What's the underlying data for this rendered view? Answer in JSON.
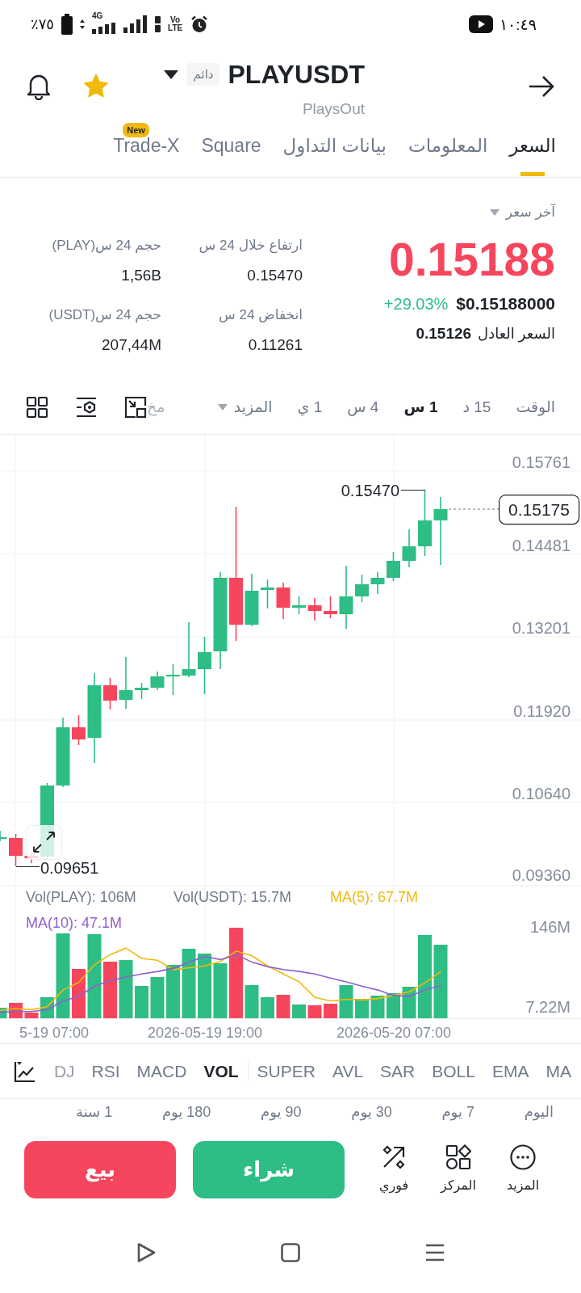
{
  "status_bar": {
    "time": "١٠:٤٩",
    "battery": "٧٥٪",
    "network": "4G",
    "volte_lines": [
      "Vo",
      "LTE"
    ]
  },
  "header": {
    "symbol": "PLAYUSDT",
    "tag": "دائم",
    "subtitle": "PlaysOut",
    "favorite": true
  },
  "tabs": [
    {
      "label": "السعر",
      "selected": true
    },
    {
      "label": "المعلومات",
      "selected": false
    },
    {
      "label": "بيانات التداول",
      "selected": false
    },
    {
      "label": "Square",
      "selected": false
    },
    {
      "badge": "New",
      "label": "Trade-X",
      "selected": false
    }
  ],
  "price_panel": {
    "label": "آخر سعر",
    "last_price": "0.15188",
    "usd_price": "$0.15188000",
    "change": "+29.03%",
    "fair_price_label": "السعر العادل",
    "fair_price": "0.15126"
  },
  "stats": [
    {
      "label": "ارتفاع خلال 24 س",
      "value": "0.15470"
    },
    {
      "label": "حجم 24 س(PLAY)",
      "value": "1,56B"
    },
    {
      "label": "انخفاض 24 س",
      "value": "0.11261"
    },
    {
      "label": "حجم 24 س(USDT)",
      "value": "207,44M"
    }
  ],
  "intervals": [
    {
      "label": "الوقت",
      "selected": false
    },
    {
      "label": "15 د",
      "selected": false
    },
    {
      "label": "1 س",
      "selected": true
    },
    {
      "label": "4 س",
      "selected": false
    },
    {
      "label": "1 ي",
      "selected": false
    }
  ],
  "more_menu": {
    "label": "المزيد"
  },
  "faded_tab": "مخ",
  "chart": {
    "price_axis": [
      "0.15761",
      "0.14481",
      "0.13201",
      "0.11920",
      "0.10640",
      "0.09360"
    ],
    "current_price": "0.15175",
    "high_marker": "0.15470",
    "low_marker": "0.09651",
    "volume_legend": [
      {
        "label": "MA(5): 67.7M",
        "color": "#f0b90b"
      },
      {
        "label": "Vol(USDT): 15.7M",
        "color": "#707a8a"
      },
      {
        "label": "Vol(PLAY): 106M",
        "color": "#707a8a"
      },
      {
        "label": "MA(10): 47.1M",
        "color": "#8e5fd0"
      }
    ],
    "volume_axis": [
      "146M",
      "7.22M"
    ],
    "time_axis": [
      "2026-05-20 07:00",
      "2026-05-19 19:00",
      "5-19 07:00"
    ]
  },
  "main_indicators": [
    {
      "label": "MA",
      "selected": false
    },
    {
      "label": "EMA",
      "selected": false
    },
    {
      "label": "BOLL",
      "selected": false
    },
    {
      "label": "SAR",
      "selected": false
    },
    {
      "label": "AVL",
      "selected": false
    },
    {
      "label": "SUPER",
      "selected": false
    }
  ],
  "sub_indicators": [
    {
      "label": "VOL",
      "selected": true,
      "faded": false
    },
    {
      "label": "MACD",
      "selected": false,
      "faded": false
    },
    {
      "label": "RSI",
      "selected": false,
      "faded": false
    },
    {
      "label": "DJ",
      "selected": false,
      "faded": true
    }
  ],
  "ranges": [
    "اليوم",
    "7 يوم",
    "30 يوم",
    "90 يوم",
    "180 يوم",
    "1 سنة"
  ],
  "actions": [
    {
      "label": "المزيد"
    },
    {
      "label": "المركز"
    },
    {
      "label": "فوري"
    }
  ],
  "trade_buttons": {
    "buy": "شراء",
    "sell": "بيع"
  }
}
